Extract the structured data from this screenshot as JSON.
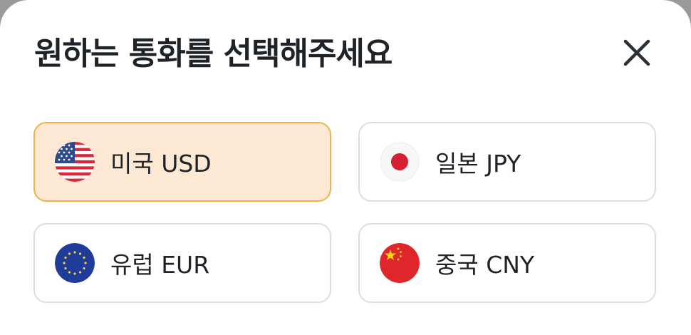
{
  "modal": {
    "title": "원하는 통화를 선택해주세요"
  },
  "currencies": [
    {
      "label": "미국 USD",
      "flag_icon": "us-flag-icon",
      "selected": true
    },
    {
      "label": "일본 JPY",
      "flag_icon": "japan-flag-icon",
      "selected": false
    },
    {
      "label": "유럽 EUR",
      "flag_icon": "eu-flag-icon",
      "selected": false
    },
    {
      "label": "중국 CNY",
      "flag_icon": "china-flag-icon",
      "selected": false
    }
  ],
  "colors": {
    "selected_bg": "#fde8d4",
    "selected_border": "#efb24a",
    "border": "#dadde1",
    "text": "#1f2328"
  }
}
